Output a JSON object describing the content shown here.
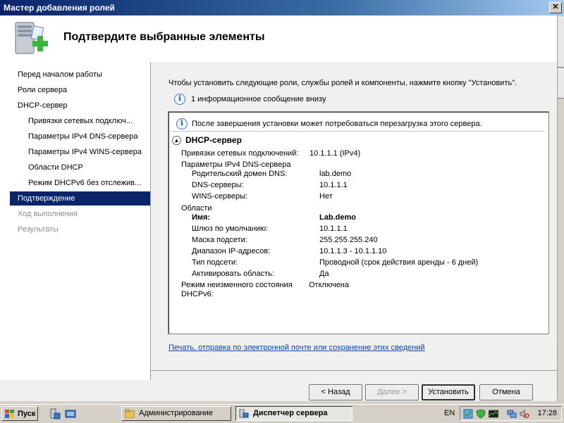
{
  "window": {
    "title": "Мастер добавления ролей",
    "close_glyph": "✕",
    "header_title": "Подтвердите выбранные элементы",
    "header_icon": "server-add-icon"
  },
  "nav": {
    "items": [
      {
        "label": "Перед началом работы",
        "state": "normal",
        "level": 0
      },
      {
        "label": "Роли сервера",
        "state": "normal",
        "level": 0
      },
      {
        "label": "DHCP-сервер",
        "state": "normal",
        "level": 0
      },
      {
        "label": "Привязки сетевых подключ...",
        "state": "normal",
        "level": 1
      },
      {
        "label": "Параметры IPv4 DNS-сервера",
        "state": "normal",
        "level": 1
      },
      {
        "label": "Параметры IPv4 WINS-сервера",
        "state": "normal",
        "level": 1
      },
      {
        "label": "Области DHCP",
        "state": "normal",
        "level": 1
      },
      {
        "label": "Режим DHCPv6 без отслежив...",
        "state": "normal",
        "level": 1
      },
      {
        "label": "Подтверждение",
        "state": "active",
        "level": 0
      },
      {
        "label": "Ход выполнения",
        "state": "disabled",
        "level": 0
      },
      {
        "label": "Результаты",
        "state": "disabled",
        "level": 0
      }
    ]
  },
  "main": {
    "instruction": "Чтобы установить следующие роли, службы ролей и компоненты, нажмите кнопку \"Установить\".",
    "info_count": "1 информационное сообщение внизу",
    "notice": "После завершения установки может потребоваться перезагрузка этого сервера.",
    "section_title": "DHCP-сервер",
    "bindings_label": "Привязки сетевых подключений:",
    "bindings_value": "10.1.1.1 (IPv4)",
    "dns_params_label": "Параметры IPv4 DNS-сервера",
    "parent_domain_label": "Родительский домен DNS:",
    "parent_domain_value": "lab.demo",
    "dns_servers_label": "DNS-серверы:",
    "dns_servers_value": "10.1.1.1",
    "wins_label": "WINS-серверы:",
    "wins_value": "Нет",
    "scopes_label": "Области",
    "name_label": "Имя:",
    "name_value": "Lab.demo",
    "gateway_label": "Шлюз по умолчанию:",
    "gateway_value": "10.1.1.1",
    "mask_label": "Маска подсети:",
    "mask_value": "255.255.255.240",
    "range_label": "Диапазон IP-адресов:",
    "range_value": "10.1.1.3 - 10.1.1.10",
    "subnet_type_label": "Тип подсети:",
    "subnet_type_value": "Проводной (срок действия аренды - 6 дней)",
    "activate_label": "Активировать область:",
    "activate_value": "Да",
    "stateless_label_1": "Режим неизменного состояния",
    "stateless_label_2": "DHCPv6:",
    "stateless_value": "Отключена",
    "print_link": "Печать, отправка по электронной почте или сохранение этих сведений"
  },
  "buttons": {
    "back": "< Назад",
    "next": "Далее >",
    "install": "Установить",
    "cancel": "Отмена"
  },
  "taskbar": {
    "start": "Пуск",
    "tasks": [
      {
        "label": "Администрирование",
        "pressed": false
      },
      {
        "label": "Диспетчер сервера",
        "pressed": true
      }
    ],
    "lang": "EN",
    "clock": "17:28"
  },
  "colors": {
    "title_gradient_start": "#0a246a",
    "selection": "#0a246a",
    "link": "#0645ad",
    "plus_green": "#3db53d"
  }
}
